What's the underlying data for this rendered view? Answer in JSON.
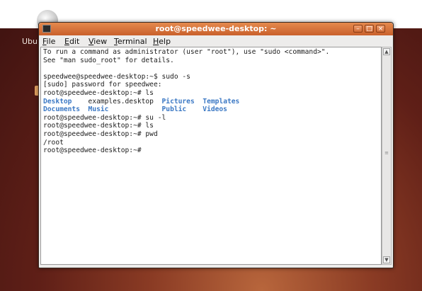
{
  "desktop": {
    "icon_label": "Ubun"
  },
  "window": {
    "title": "root@speedwee-desktop: ~",
    "buttons": {
      "minimize": "–",
      "maximize": "□",
      "close": "×"
    }
  },
  "menubar": {
    "file": {
      "u": "F",
      "rest": "ile"
    },
    "edit": {
      "u": "E",
      "rest": "dit"
    },
    "view": {
      "u": "V",
      "rest": "iew"
    },
    "terminal": {
      "u": "T",
      "rest": "erminal"
    },
    "help": {
      "u": "H",
      "rest": "elp"
    }
  },
  "terminal": {
    "line1": "To run a command as administrator (user \"root\"), use \"sudo <command>\".",
    "line2": "See \"man sudo_root\" for details.",
    "line3": "",
    "line4": "speedwee@speedwee-desktop:~$ sudo -s",
    "line5": "[sudo] password for speedwee:",
    "line6": "root@speedwee-desktop:~# ls",
    "ls": {
      "desktop": "Desktop",
      "examples": "examples.desktop",
      "pictures": "Pictures",
      "templates": "Templates",
      "documents": "Documents",
      "music": "Music",
      "public": "Public",
      "videos": "Videos"
    },
    "line9": "root@speedwee-desktop:~# su -l",
    "line10": "root@speedwee-desktop:~# ls",
    "line11": "root@speedwee-desktop:~# pwd",
    "line12": "/root",
    "line13": "root@speedwee-desktop:~# "
  },
  "colors": {
    "titlebar": "#d8743d",
    "directory": "#3b78c4"
  },
  "icons": {
    "terminal_icon": "terminal-icon",
    "scroll_up": "arrow-up-icon",
    "scroll_down": "arrow-down-icon"
  }
}
